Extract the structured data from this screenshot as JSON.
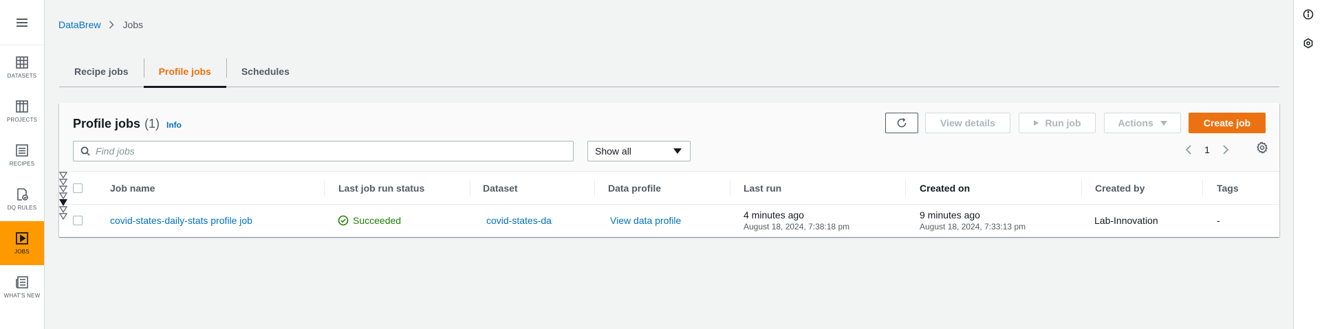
{
  "nav": {
    "items": [
      {
        "label": "DATASETS",
        "icon": "table-grid-icon"
      },
      {
        "label": "PROJECTS",
        "icon": "grid-icon"
      },
      {
        "label": "RECIPES",
        "icon": "list-icon"
      },
      {
        "label": "DQ RULES",
        "icon": "doc-check-icon"
      },
      {
        "label": "JOBS",
        "icon": "play-icon",
        "active": true
      },
      {
        "label": "WHAT'S NEW",
        "icon": "news-icon"
      }
    ]
  },
  "breadcrumb": {
    "parent": "DataBrew",
    "current": "Jobs"
  },
  "tabs": [
    "Recipe jobs",
    "Profile jobs",
    "Schedules"
  ],
  "active_tab": "Profile jobs",
  "panel": {
    "title": "Profile jobs",
    "count": "(1)",
    "info": "Info",
    "buttons": {
      "view_details": "View details",
      "run_job": "Run job",
      "actions": "Actions",
      "create_job": "Create job"
    },
    "search_placeholder": "Find jobs",
    "filter_value": "Show all",
    "page": "1"
  },
  "table": {
    "columns": [
      "Job name",
      "Last job run status",
      "Dataset",
      "Data profile",
      "Last run",
      "Created on",
      "Created by",
      "Tags"
    ],
    "sorted_column": "Created on",
    "rows": [
      {
        "job_name": "covid-states-daily-stats profile job",
        "status": "Succeeded",
        "dataset": "covid-states-daily-stats",
        "data_profile": "View data profile",
        "last_run": "4 minutes ago",
        "last_run_date": "August 18, 2024, 7:38:18 pm",
        "created_on": "9 minutes ago",
        "created_on_date": "August 18, 2024, 7:33:13 pm",
        "created_by": "Lab-Innovation",
        "tags": "-"
      }
    ]
  },
  "colors": {
    "accent": "#ec7211",
    "nav_active": "#ff9900",
    "link": "#0073bb",
    "success": "#1d8102"
  }
}
